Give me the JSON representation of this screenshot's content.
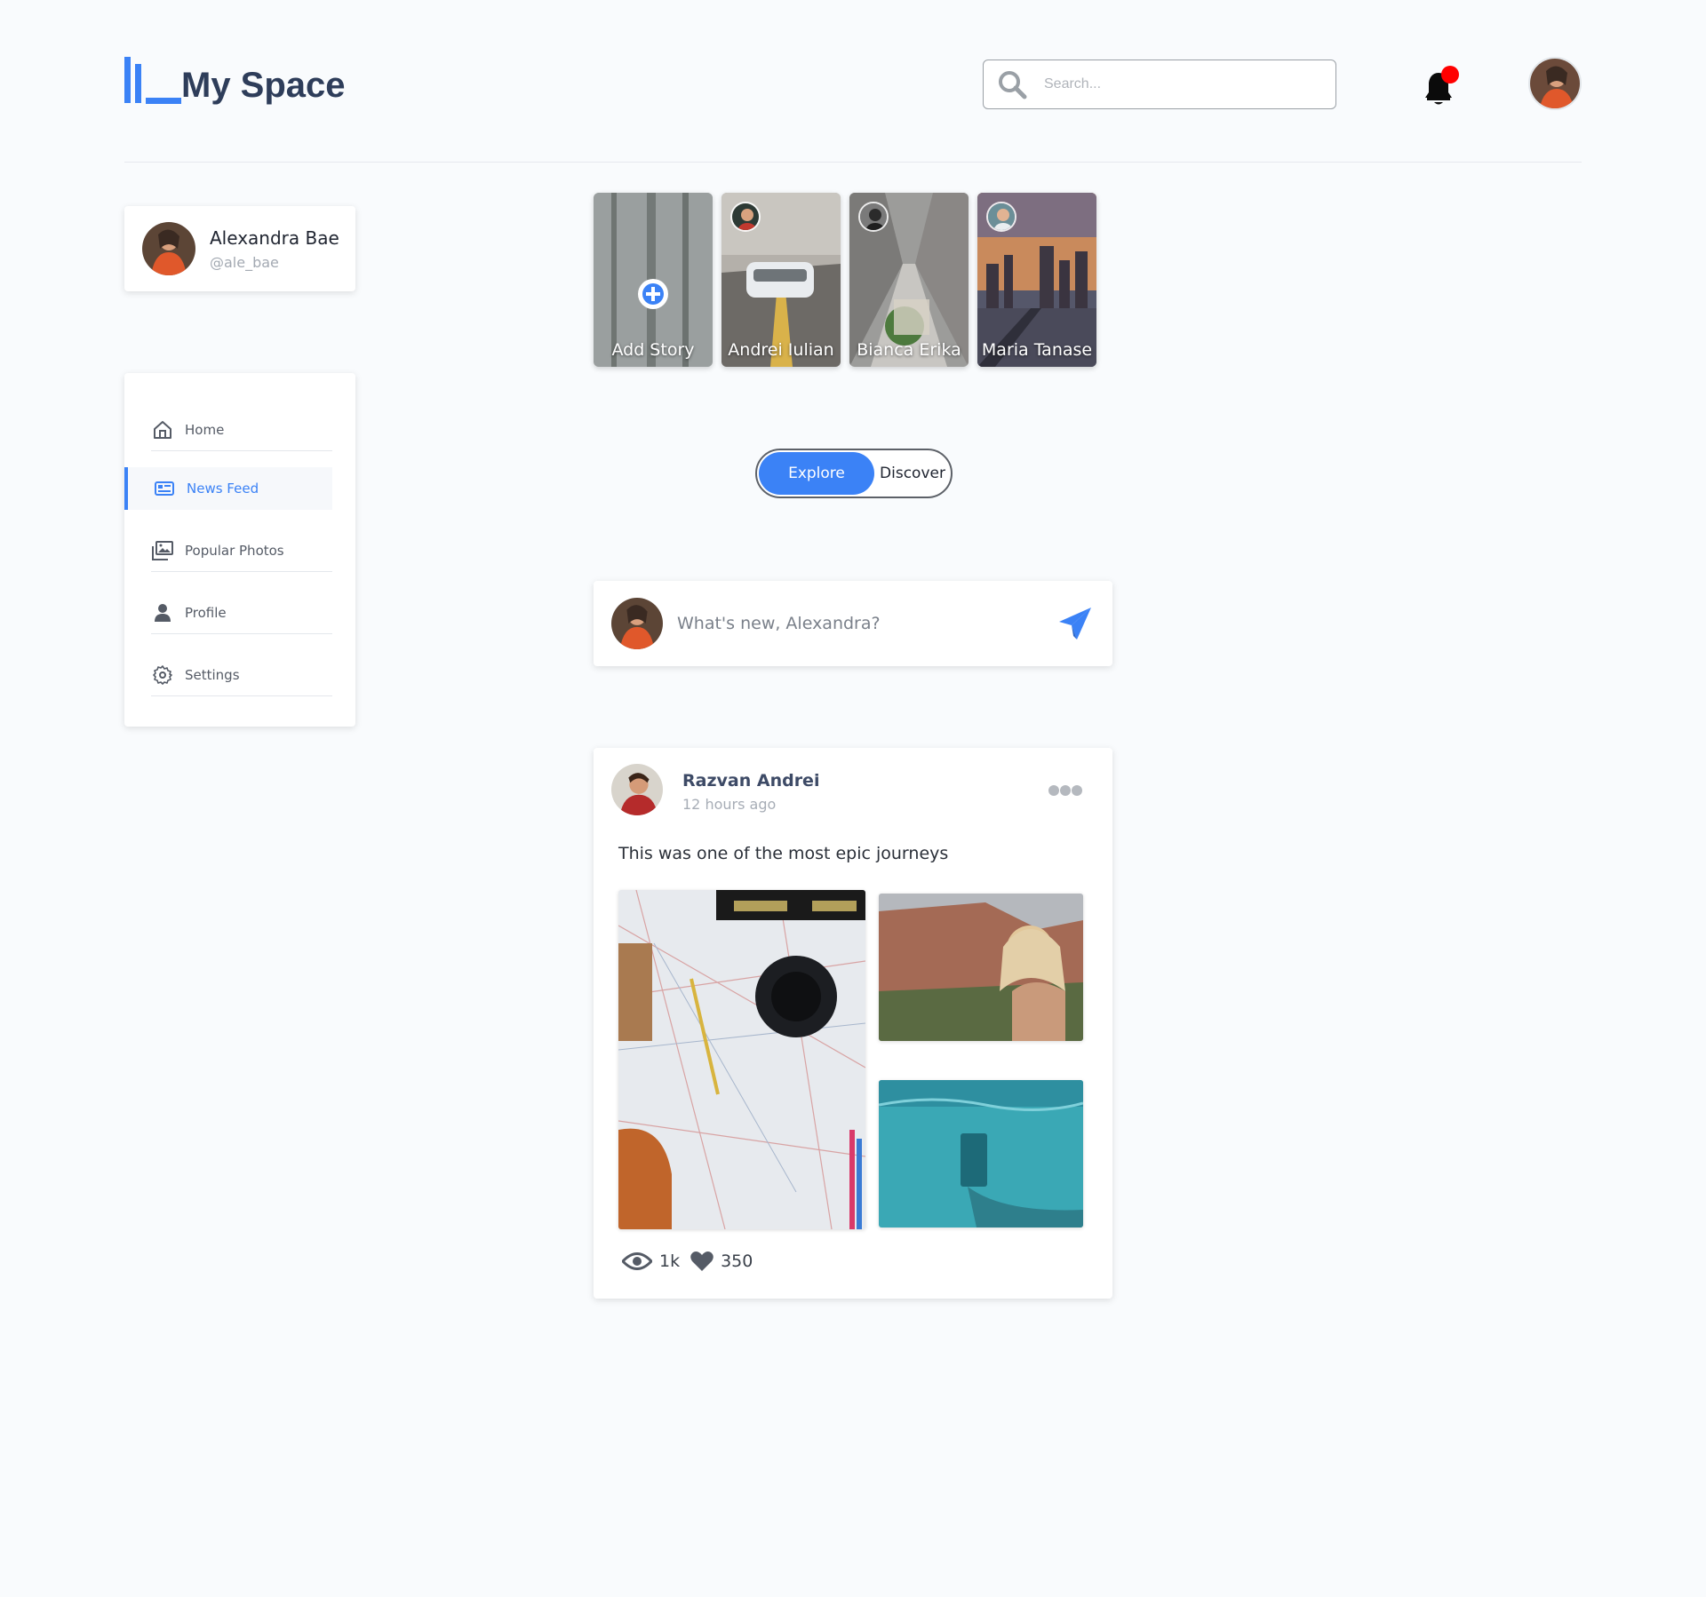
{
  "app": {
    "title": "My Space"
  },
  "search": {
    "placeholder": "Search..."
  },
  "profile": {
    "name": "Alexandra Bae",
    "handle": "@ale_bae"
  },
  "nav": {
    "items": [
      {
        "label": "Home",
        "icon": "home-icon",
        "active": false
      },
      {
        "label": "News Feed",
        "icon": "news-feed-icon",
        "active": true
      },
      {
        "label": "Popular Photos",
        "icon": "photos-icon",
        "active": false
      },
      {
        "label": "Profile",
        "icon": "user-icon",
        "active": false
      },
      {
        "label": "Settings",
        "icon": "gear-icon",
        "active": false
      }
    ]
  },
  "stories": [
    {
      "label": "Add Story"
    },
    {
      "label": "Andrei Iulian"
    },
    {
      "label": "Bianca Erika"
    },
    {
      "label": "Maria Tanase"
    }
  ],
  "toggle": {
    "explore": "Explore",
    "discover": "Discover",
    "selected": "Explore"
  },
  "composer": {
    "placeholder": "What's new, Alexandra?"
  },
  "post": {
    "author": "Razvan Andrei",
    "time": "12 hours ago",
    "text": "This was one of the most epic journeys",
    "views": "1k",
    "likes": "350"
  },
  "colors": {
    "accent": "#3b82f6",
    "notification": "#ff0000",
    "logo_text": "#2e3d5a"
  }
}
